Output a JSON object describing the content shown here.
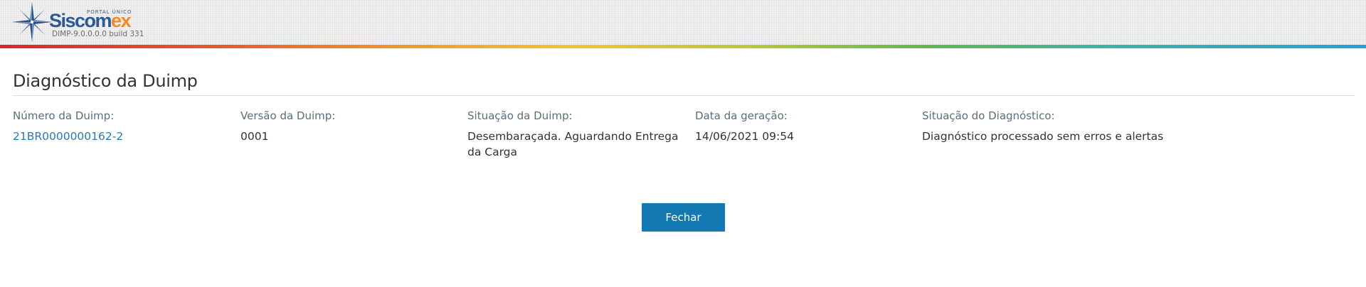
{
  "header": {
    "portal_label": "PORTAL ÚNICO",
    "brand_part1": "Siscom",
    "brand_part2": "ex",
    "version": "DIMP-9.0.0.0.0 build 331",
    "brand_color": "#2c5896",
    "accent_color": "#f08a24"
  },
  "page": {
    "title": "Diagnóstico da Duimp"
  },
  "fields": [
    {
      "label": "Número da Duimp:",
      "value": "21BR0000000162-2"
    },
    {
      "label": "Versão da Duimp:",
      "value": "0001"
    },
    {
      "label": "Situação da Duimp:",
      "value": "Desembaraçada. Aguardando Entrega da Carga"
    },
    {
      "label": "Data da geração:",
      "value": "14/06/2021 09:54"
    },
    {
      "label": "Situação do Diagnóstico:",
      "value": "Diagnóstico processado sem erros e alertas"
    }
  ],
  "actions": {
    "close_label": "Fechar",
    "close_color": "#1279b3"
  }
}
